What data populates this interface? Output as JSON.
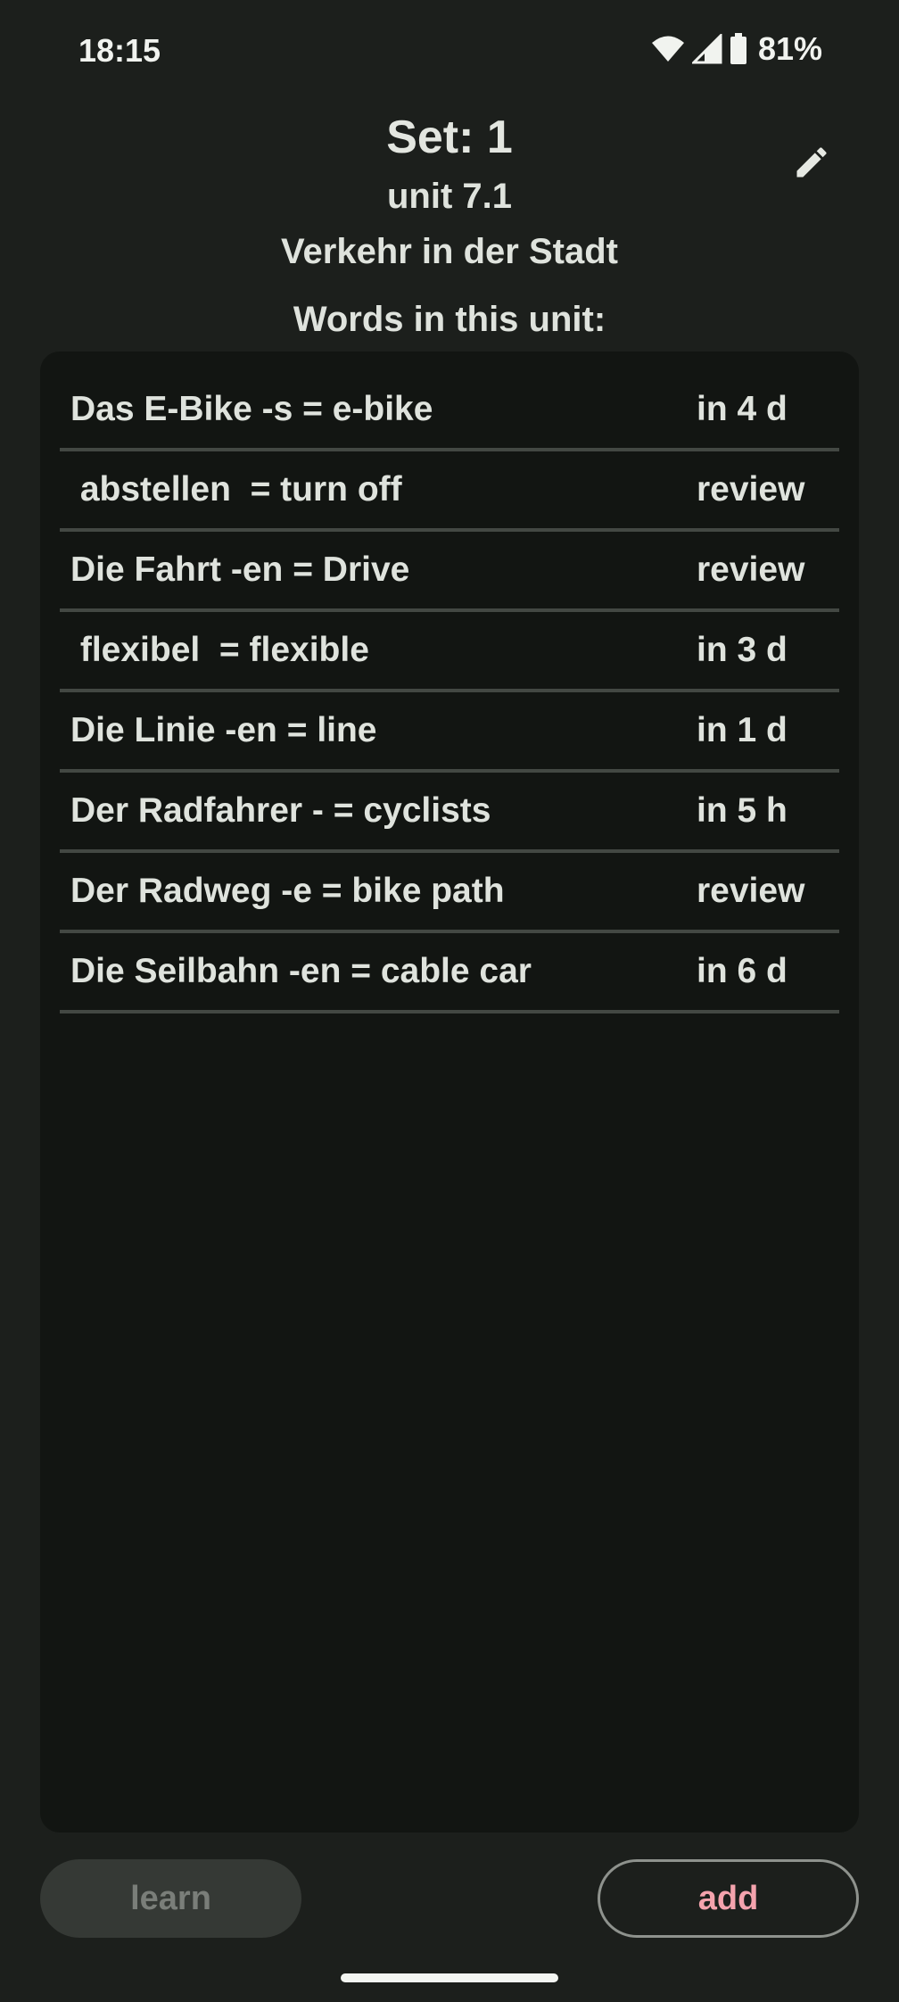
{
  "status": {
    "time": "18:15",
    "battery": "81%"
  },
  "header": {
    "set_title": "Set: 1",
    "unit": "unit 7.1",
    "topic": "Verkehr in der Stadt",
    "edit_icon": "pencil-icon"
  },
  "words_heading": "Words in this unit:",
  "words": [
    {
      "text": "Das E-Bike -s = e-bike",
      "due": "in 4 d"
    },
    {
      "text": " abstellen  = turn off",
      "due": "review"
    },
    {
      "text": "Die Fahrt -en = Drive",
      "due": "review"
    },
    {
      "text": " flexibel  = flexible",
      "due": "in 3 d"
    },
    {
      "text": "Die Linie -en = line",
      "due": "in 1 d"
    },
    {
      "text": "Der Radfahrer - = cyclists",
      "due": "in 5 h"
    },
    {
      "text": "Der Radweg -e = bike path",
      "due": "review"
    },
    {
      "text": "Die Seilbahn -en = cable car",
      "due": "in 6 d"
    }
  ],
  "buttons": {
    "learn": "learn",
    "add": "add"
  },
  "colors": {
    "background": "#1c1f1c",
    "panel": "#121512",
    "accent_pink": "#f4a3ad"
  }
}
